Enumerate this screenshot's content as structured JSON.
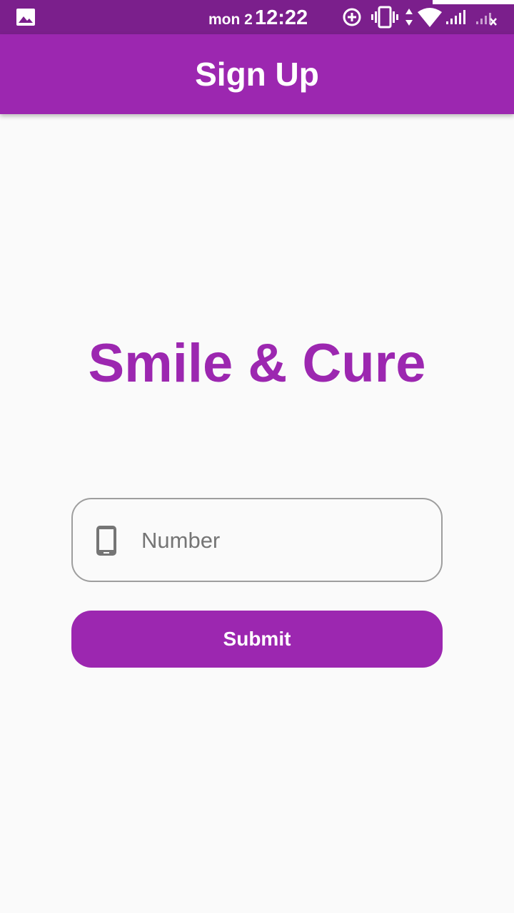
{
  "status_bar": {
    "day": "mon 2",
    "time": "12:22",
    "icons": [
      "gallery-icon",
      "data-saver-icon",
      "vibrate-icon",
      "data-transfer-icon",
      "wifi-icon",
      "signal-icon",
      "no-signal-icon"
    ]
  },
  "app_bar": {
    "title": "Sign Up",
    "color": "#9c27b0"
  },
  "brand": {
    "name": "Smile & Cure",
    "color": "#9c27b0"
  },
  "form": {
    "phone_placeholder": "Number",
    "phone_icon": "phone-icon",
    "submit_label": "Submit"
  }
}
